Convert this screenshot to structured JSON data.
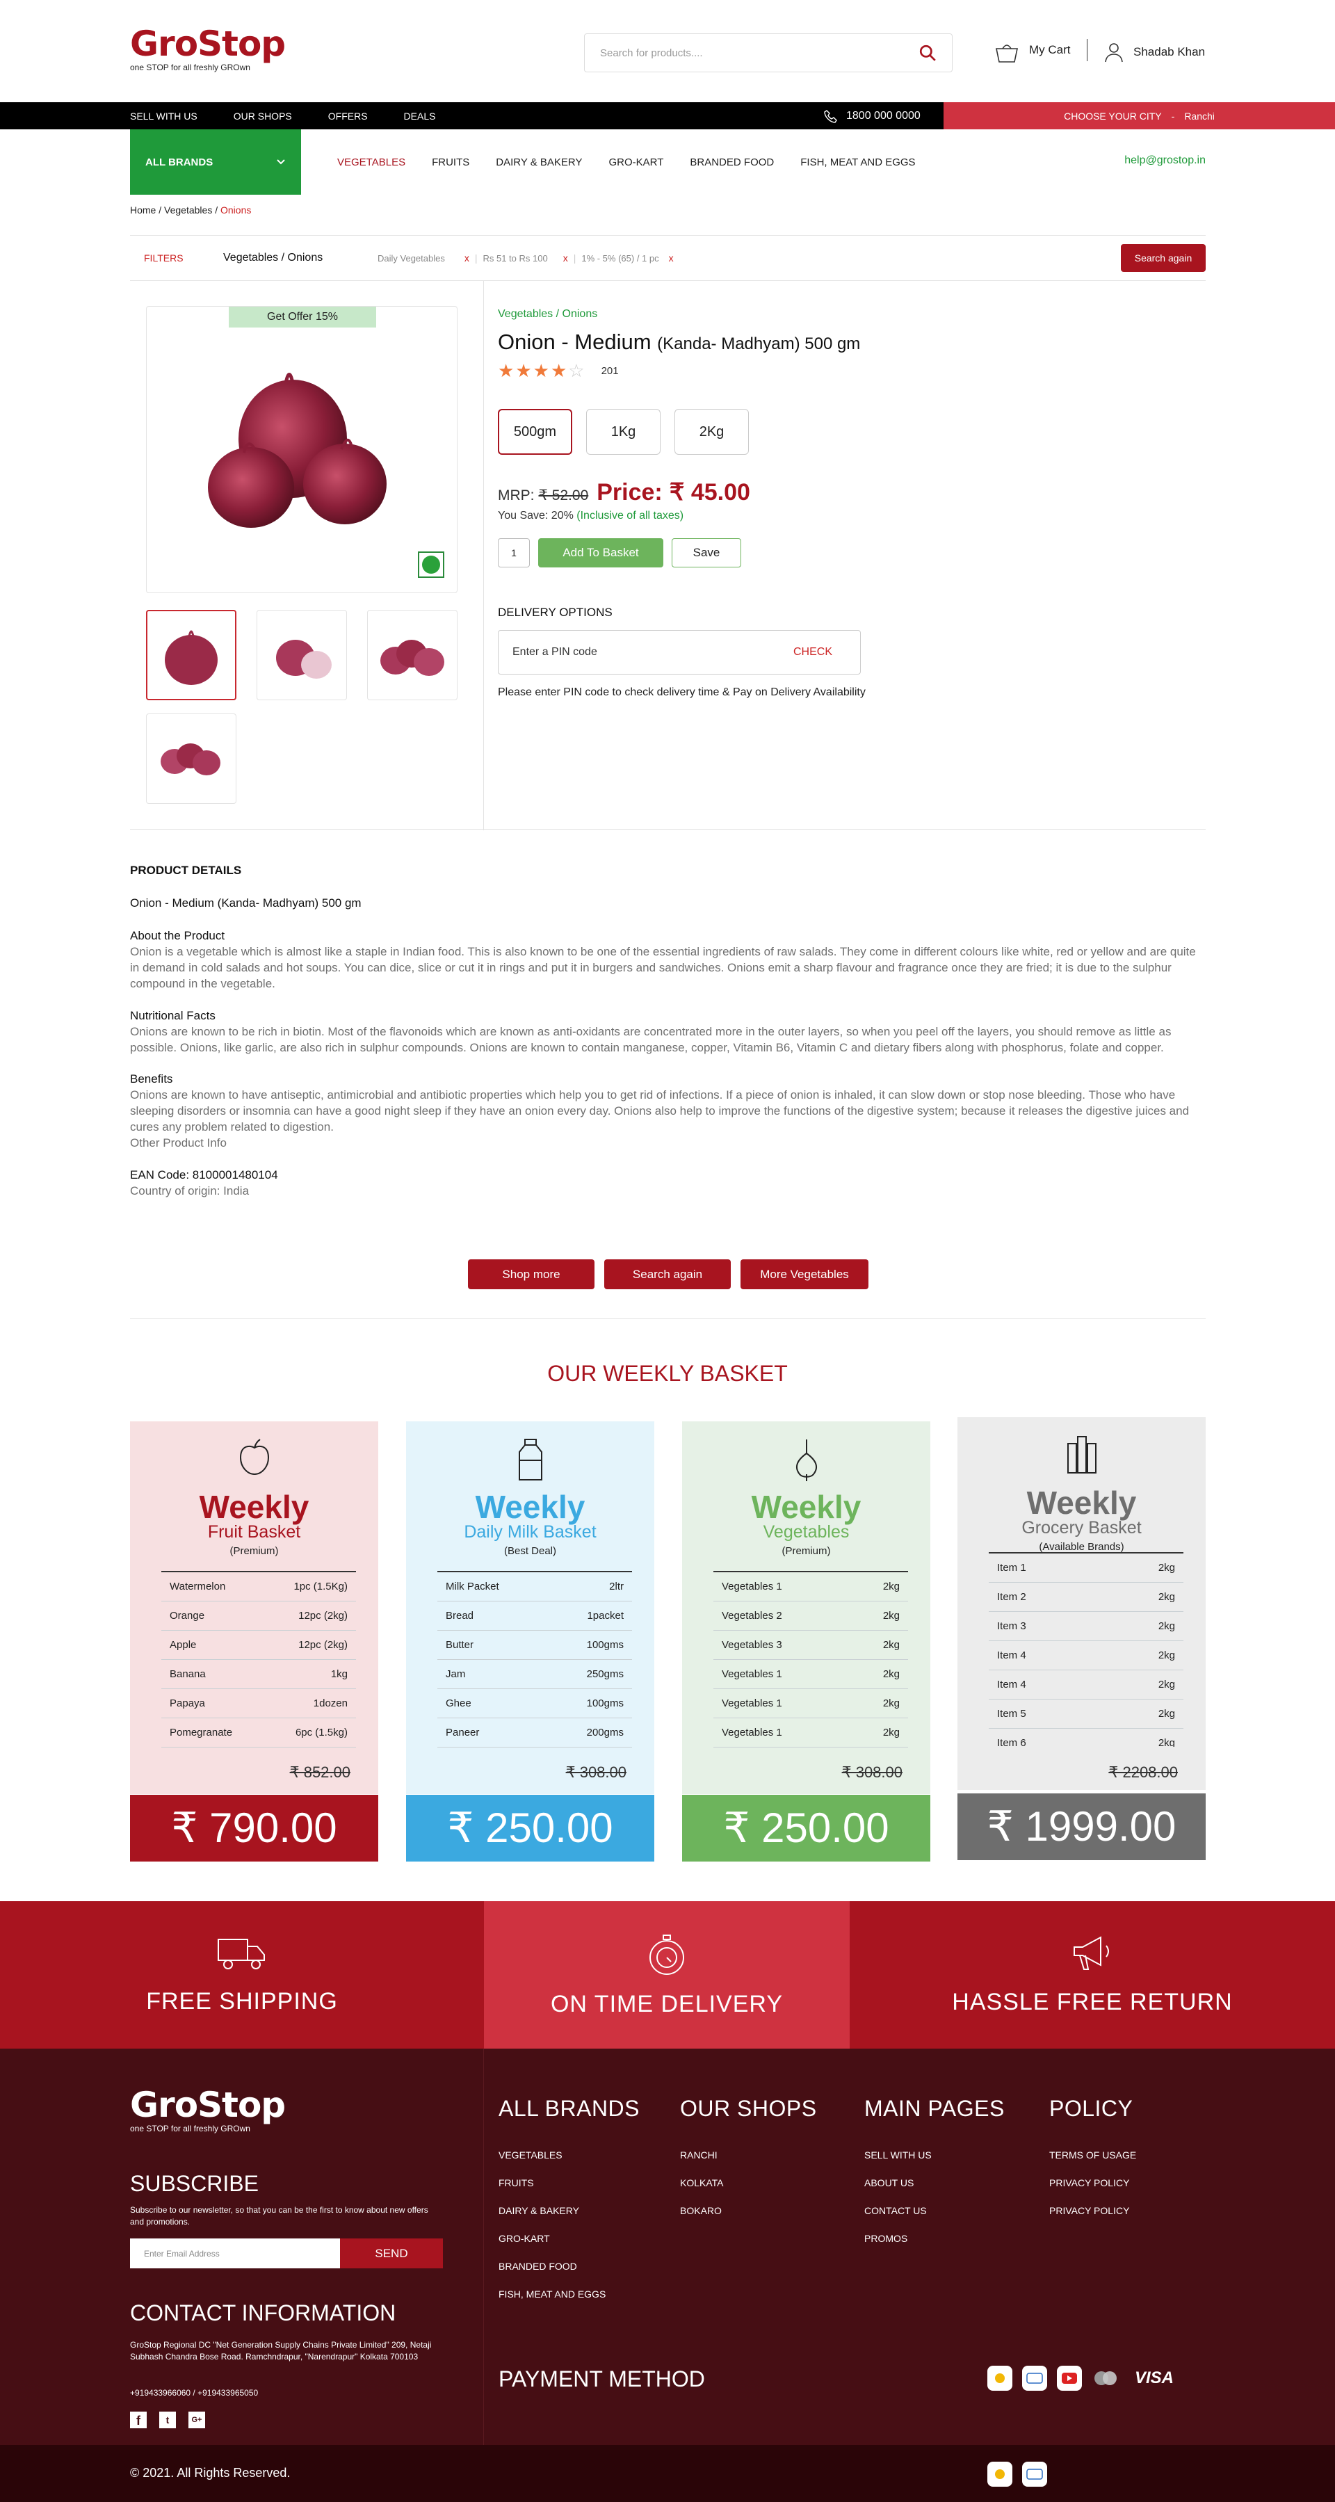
{
  "header": {
    "logo": "GroStop",
    "tagline": "one STOP for all freshly GROwn",
    "search_placeholder": "Search for products....",
    "cart_label": "My Cart",
    "user_name": "Shadab Khan"
  },
  "topbar": {
    "links": [
      "SELL WITH US",
      "OUR SHOPS",
      "OFFERS",
      "DEALS"
    ],
    "phone": "1800 000 0000",
    "city_label": "CHOOSE YOUR CITY",
    "city_sep": "-",
    "city": "Ranchi"
  },
  "nav": {
    "all_brands": "ALL BRANDS",
    "categories": [
      "VEGETABLES",
      "FRUITS",
      "DAIRY & BAKERY",
      "GRO-KART",
      "BRANDED FOOD",
      "FISH, MEAT AND EGGS"
    ],
    "help_email": "help@grostop.in"
  },
  "breadcrumb": {
    "home": "Home",
    "sep": "/",
    "cat": "Vegetables",
    "current": "Onions"
  },
  "filters": {
    "label": "FILTERS",
    "path": "Vegetables / Onions",
    "chips": [
      "Daily Vegetables",
      "Rs 51 to Rs 100",
      "1% - 5% (65) / 1 pc"
    ],
    "remove": "x",
    "search_again": "Search again"
  },
  "product": {
    "offer": "Get Offer 15%",
    "category": "Vegetables / Onions",
    "name": "Onion - Medium",
    "name_sub": "(Kanda- Madhyam) 500 gm",
    "rating": 4,
    "rating_count": "201",
    "sizes": [
      "500gm",
      "1Kg",
      "2Kg"
    ],
    "mrp_label": "MRP:",
    "mrp": "₹ 52.00",
    "price_label": "Price:",
    "price": "₹ 45.00",
    "save_text": "You Save: 20%",
    "tax_text": "(Inclusive of all taxes)",
    "qty": "1",
    "add_label": "Add To Basket",
    "save_label": "Save",
    "delivery_title": "DELIVERY OPTIONS",
    "pin_placeholder": "Enter a PIN code",
    "check": "CHECK",
    "pin_note": "Please enter PIN code to check delivery time & Pay on Delivery Availability"
  },
  "details": {
    "title": "PRODUCT DETAILS",
    "name": "Onion - Medium (Kanda- Madhyam) 500 gm",
    "about_h": "About the Product",
    "about": "Onion is a vegetable which is almost like a staple in Indian food. This is also known to be one of the essential ingredients of raw salads. They come in different colours like white, red or yellow and are quite in demand in cold salads and hot soups. You can dice, slice or cut it in rings and put it in burgers and sandwiches. Onions emit a sharp flavour and fragrance once they are fried; it is due to the sulphur compound in the vegetable.",
    "nutri_h": "Nutritional Facts",
    "nutri": "Onions are known to be rich in biotin. Most of the flavonoids which are known as anti-oxidants are concentrated more in the outer layers, so when you peel off the layers, you should remove as little as possible. Onions, like garlic, are also rich in sulphur compounds. Onions are known to contain manganese, copper, Vitamin B6, Vitamin C and dietary fibers along with phosphorus, folate and copper.",
    "benefits_h": "Benefits",
    "benefits": "Onions are known to have antiseptic, antimicrobial and antibiotic properties which help you to get rid of infections. If a piece of onion is inhaled, it can slow down or stop nose bleeding. Those who have sleeping disorders or insomnia can have a good night sleep if they have an onion every day. Onions also help to improve the functions of the digestive system; because it releases the digestive juices and cures any problem related to digestion.",
    "other": "Other Product Info",
    "ean": "EAN Code: 8100001480104",
    "origin": "Country of origin: India"
  },
  "actions": [
    "Shop more",
    "Search again",
    "More Vegetables"
  ],
  "weekly": {
    "title": "OUR WEEKLY BASKET",
    "cards": [
      {
        "t1": "Weekly",
        "t2": "Fruit Basket",
        "t3": "(Premium)",
        "items": [
          [
            "Watermelon",
            "1pc (1.5Kg)"
          ],
          [
            "Orange",
            "12pc (2kg)"
          ],
          [
            "Apple",
            "12pc (2kg)"
          ],
          [
            "Banana",
            "1kg"
          ],
          [
            "Papaya",
            "1dozen"
          ],
          [
            "Pomegranate",
            "6pc (1.5kg)"
          ]
        ],
        "mrp": "₹ 852.00",
        "price": "₹ 790.00",
        "color": "#a8141f",
        "bg": "#f7e0e1"
      },
      {
        "t1": "Weekly",
        "t2": "Daily Milk Basket",
        "t3": "(Best Deal)",
        "items": [
          [
            "Milk Packet",
            "2ltr"
          ],
          [
            "Bread",
            "1packet"
          ],
          [
            "Butter",
            "100gms"
          ],
          [
            "Jam",
            "250gms"
          ],
          [
            "Ghee",
            "100gms"
          ],
          [
            "Paneer",
            "200gms"
          ]
        ],
        "mrp": "₹ 308.00",
        "price": "₹ 250.00",
        "color": "#3ba9e0",
        "bg": "#e4f4fb"
      },
      {
        "t1": "Weekly",
        "t2": "Vegetables",
        "t3": "(Premium)",
        "items": [
          [
            "Vegetables 1",
            "2kg"
          ],
          [
            "Vegetables 2",
            "2kg"
          ],
          [
            "Vegetables 3",
            "2kg"
          ],
          [
            "Vegetables 1",
            "2kg"
          ],
          [
            "Vegetables 1",
            "2kg"
          ],
          [
            "Vegetables 1",
            "2kg"
          ]
        ],
        "mrp": "₹ 308.00",
        "price": "₹ 250.00",
        "color": "#6db45c",
        "bg": "#e6f1e6"
      },
      {
        "t1": "Weekly",
        "t2": "Grocery Basket",
        "t3": "(Available Brands)",
        "items": [
          [
            "Item 1",
            "2kg"
          ],
          [
            "Item 2",
            "2kg"
          ],
          [
            "Item 3",
            "2kg"
          ],
          [
            "Item 4",
            "2kg"
          ],
          [
            "Item 4",
            "2kg"
          ],
          [
            "Item 5",
            "2kg"
          ],
          [
            "Item 6",
            "2kg"
          ]
        ],
        "mrp": "₹ 2208.00",
        "price": "₹ 1999.00",
        "color": "#6e6e6e",
        "bg": "#ececec"
      }
    ]
  },
  "services": [
    "FREE SHIPPING",
    "ON TIME DELIVERY",
    "HASSLE FREE RETURN"
  ],
  "footer": {
    "subscribe_h": "SUBSCRIBE",
    "subscribe_text": "Subscribe to our newsletter, so that you can be the first to know about new offers and promotions.",
    "email_placeholder": "Enter Email Address",
    "send": "SEND",
    "contact_h": "CONTACT INFORMATION",
    "address": "GroStop Regional DC \"Net Generation Supply Chains Private Limited\" 209, Netaji Subhash Chandra Bose Road. Ramchndrapur, \"Narendrapur\" Kolkata 700103",
    "phones": "+919433966060 / +919433965050",
    "cols": [
      {
        "h": "ALL BRANDS",
        "links": [
          "VEGETABLES",
          "FRUITS",
          "DAIRY & BAKERY",
          "GRO-KART",
          "BRANDED FOOD",
          "FISH, MEAT AND EGGS"
        ]
      },
      {
        "h": "OUR SHOPS",
        "links": [
          "RANCHI",
          "KOLKATA",
          "BOKARO"
        ]
      },
      {
        "h": "MAIN PAGES",
        "links": [
          "SELL WITH US",
          "ABOUT US",
          "CONTACT US",
          "PROMOS"
        ]
      },
      {
        "h": "POLICY",
        "links": [
          "TERMS OF USAGE",
          "PRIVACY POLICY",
          "PRIVACY POLICY"
        ]
      }
    ],
    "payment_h": "PAYMENT METHOD",
    "visa": "VISA",
    "copyright": "© 2021. All Rights Reserved."
  }
}
